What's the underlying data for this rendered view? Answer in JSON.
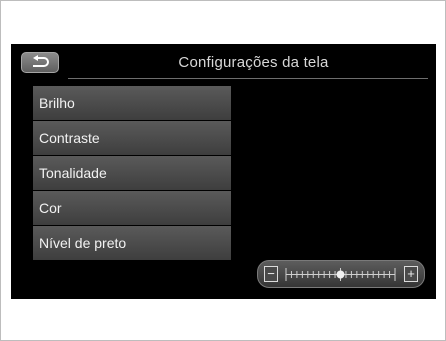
{
  "header": {
    "title": "Configurações da tela",
    "back_icon": "return-arrow-icon"
  },
  "menu": {
    "items": [
      {
        "label": "Brilho"
      },
      {
        "label": "Contraste"
      },
      {
        "label": "Tonalidade"
      },
      {
        "label": "Cor"
      },
      {
        "label": "Nível de preto"
      }
    ]
  },
  "slider": {
    "minus_label": "−",
    "plus_label": "+",
    "value_fraction": 0.5,
    "ticks": 21
  },
  "colors": {
    "background": "#000000",
    "menu_item": "#4c4c4c",
    "text": "#f2f2f2"
  }
}
